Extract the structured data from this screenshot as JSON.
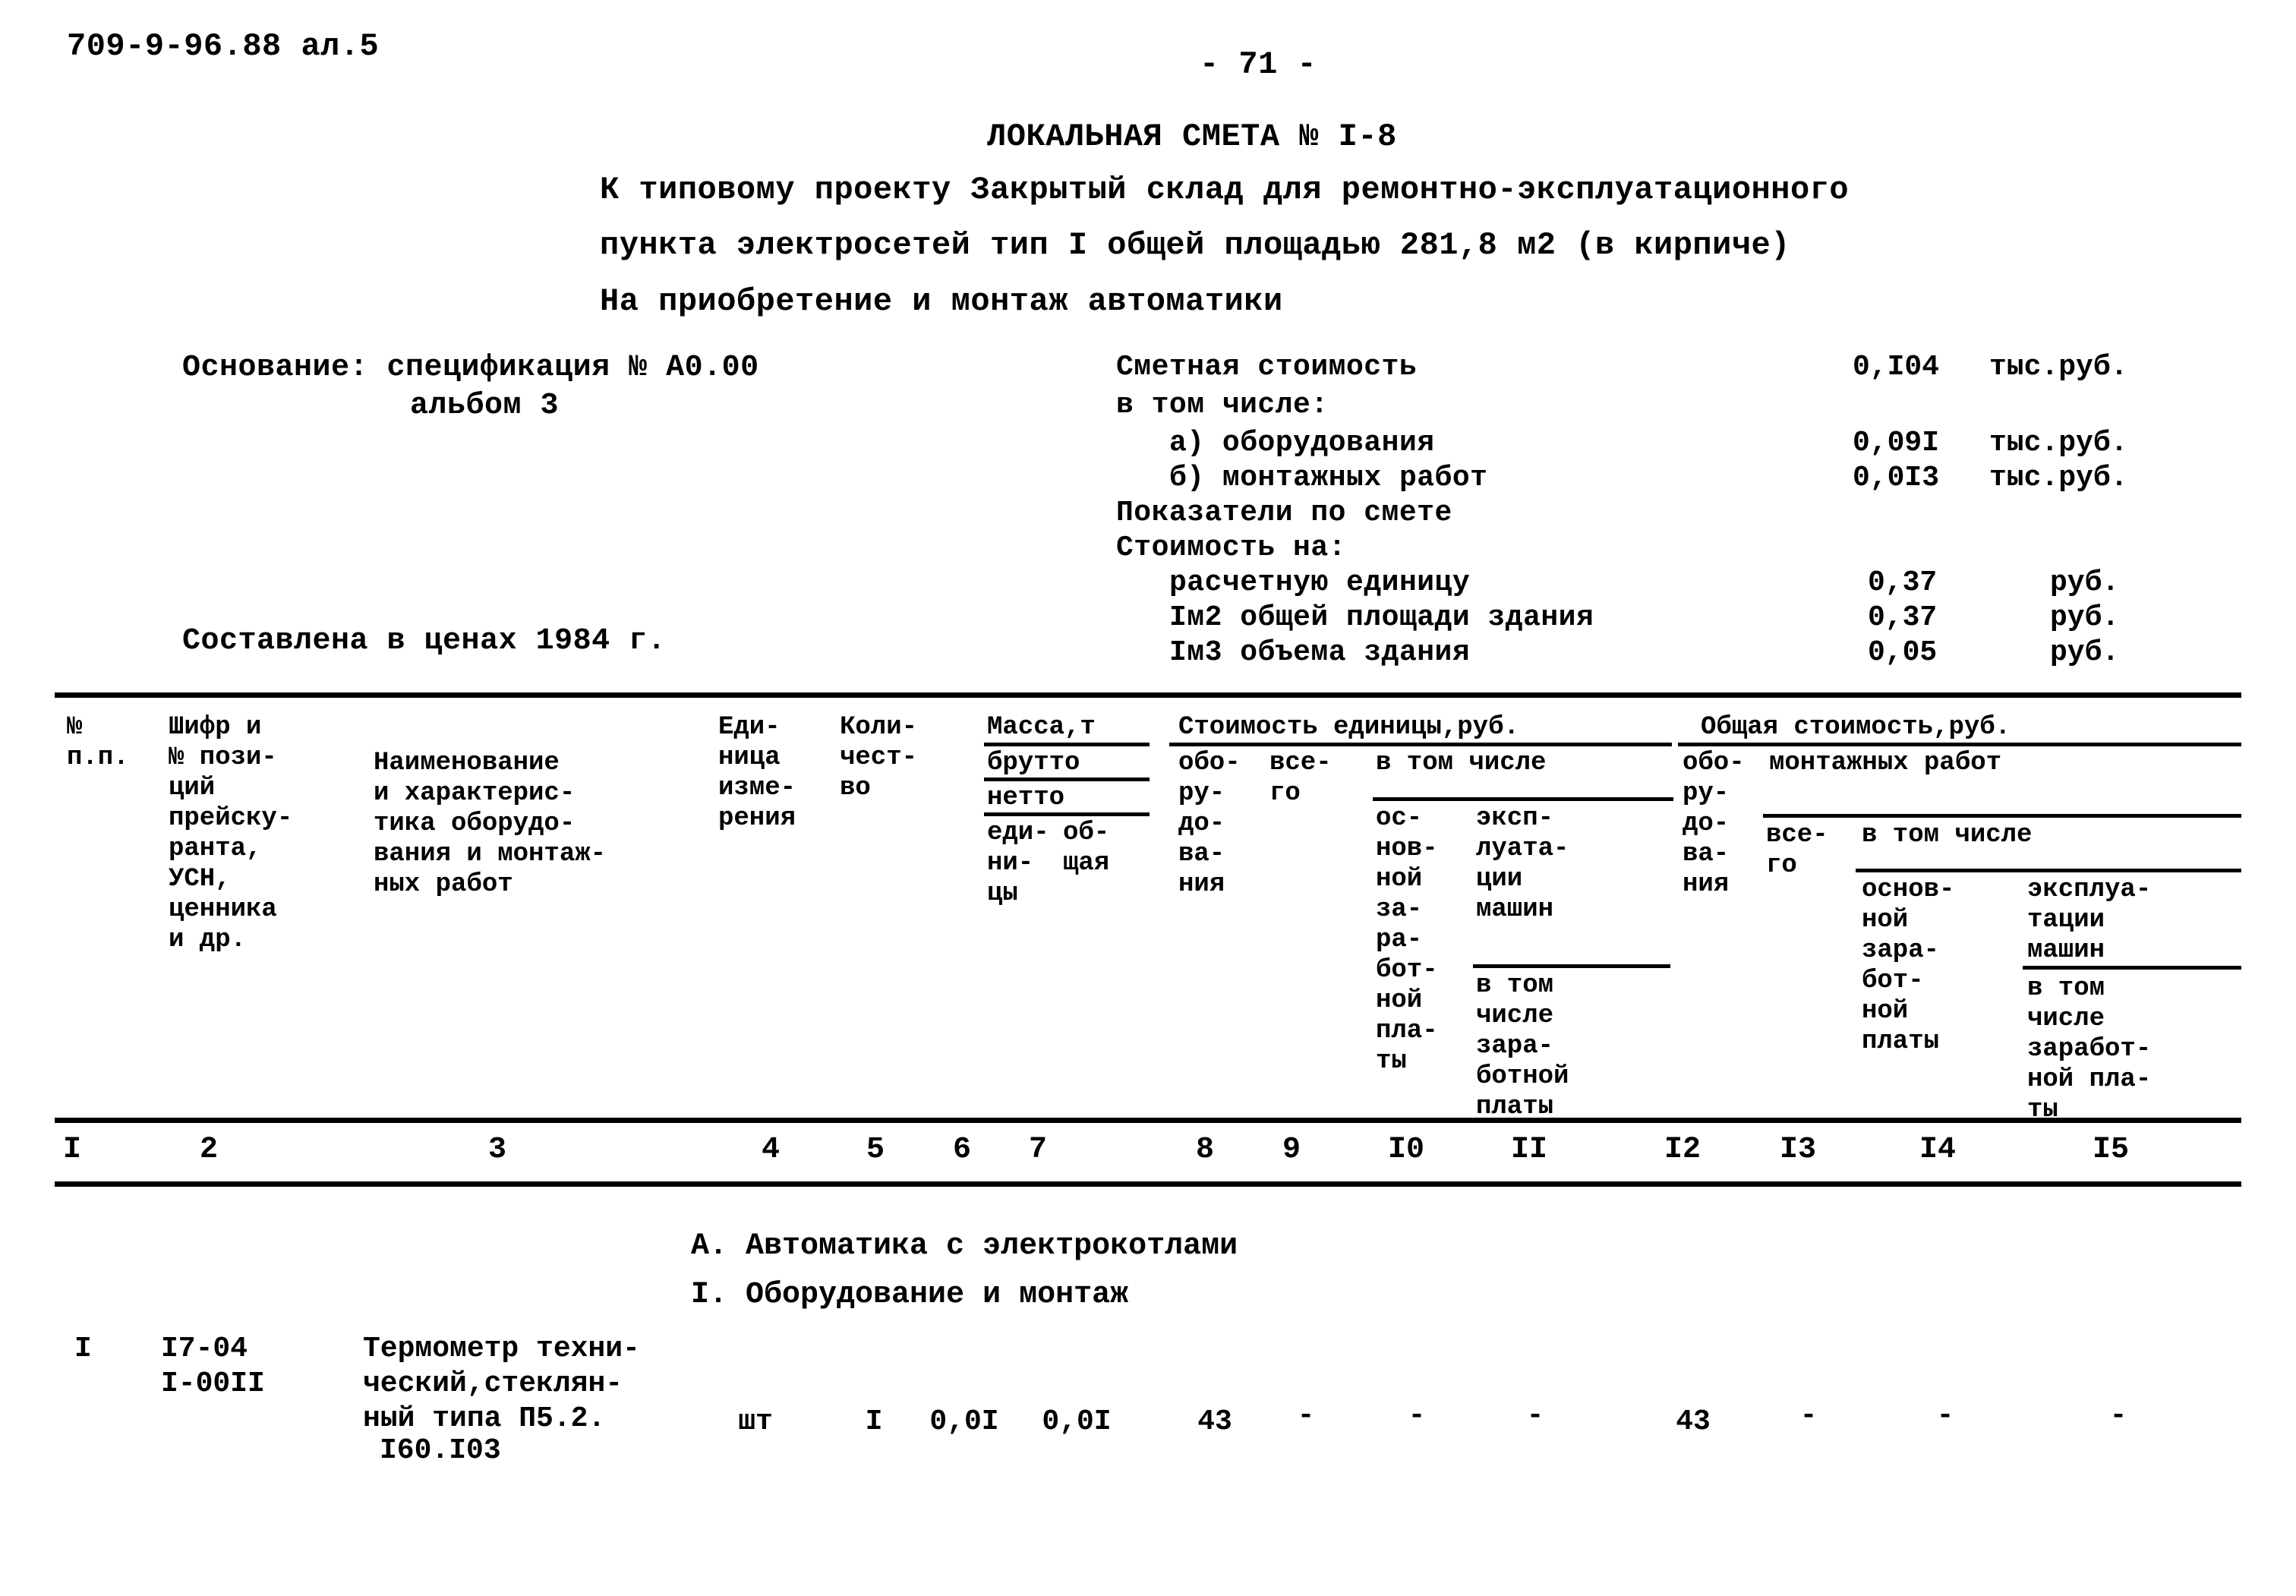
{
  "document": {
    "doc_code": "709-9-96.88 ал.5",
    "page_number": "- 71 -",
    "title": "ЛОКАЛЬНАЯ СМЕТА № I-8",
    "subtitle_line1": "К типовому проекту Закрытый склад для ремонтно-эксплуатационного",
    "subtitle_line2": "пункта электросетей тип I общей площадью 281,8 м2 (в кирпиче)",
    "subtitle_line3": "На приобретение и монтаж автоматики"
  },
  "basis": {
    "label": "Основание: спецификация № А0.00",
    "line2": "альбом 3",
    "prices_note": "Составлена в ценах 1984 г."
  },
  "summary": {
    "total_label": "Сметная стоимость",
    "total_value": "0,I04",
    "total_unit": "тыс.руб.",
    "including_label": "в том числе:",
    "equipment_label": "а) оборудования",
    "equipment_value": "0,09I",
    "equipment_unit": "тыс.руб.",
    "install_label": "б) монтажных работ",
    "install_value": "0,0I3",
    "install_unit": "тыс.руб.",
    "indicators_label": "Показатели по смете",
    "cost_per_label": "Стоимость на:",
    "unit_calc_label": "расчетную единицу",
    "unit_calc_value": "0,37",
    "unit_calc_unit": "руб.",
    "per_m2_label": "Iм2 общей площади здания",
    "per_m2_value": "0,37",
    "per_m2_unit": "руб.",
    "per_m3_label": "Iм3 объема здания",
    "per_m3_value": "0,05",
    "per_m3_unit": "руб."
  },
  "table": {
    "headers": {
      "c1": "№\nп.п.",
      "c2": "Шифр и\n№ пози-\nций\nпрейску-\nранта,\nУСН,\nценника\nи др.",
      "c3": "Наименование\nи характерис-\nтика оборудо-\nвания и монтаж-\nных работ",
      "c4": "Еди-\nница\nизме-\nрения",
      "c5": "Коли-\nчест-\nво",
      "mass_group": "Масса,т",
      "c6_top": "брутто",
      "c7_top": "нетто",
      "c6": "еди-\nни-\nцы",
      "c7": "об-\nщая",
      "unit_cost_group": "Стоимость единицы,руб.",
      "c8": "обо-\nру-\nдо-\nва-\nния",
      "c9": "все-\nго",
      "incl_unit": "в том числе",
      "c10": "ос-\nнов-\nной\nза-\nра-\nбот-\nной\nпла-\nты",
      "c11": "эксп-\nлуата-\nции\nмашин",
      "c11_sub": "в том\nчисле\nзара-\nботной\nплаты",
      "total_cost_group": "Общая стоимость,руб.",
      "c12": "обо-\nру-\nдо-\nва-\nния",
      "install_group": "монтажных работ",
      "c13": "все-\nго",
      "incl_total": "в том числе",
      "c14": "основ-\nной\nзара-\nбот-\nной\nплаты",
      "c15": "эксплуа-\nтации\nмашин",
      "c15_sub": "в том\nчисле\nзаработ-\nной пла-\nты"
    },
    "column_numbers": [
      "I",
      "2",
      "3",
      "4",
      "5",
      "6",
      "7",
      "8",
      "9",
      "I0",
      "II",
      "I2",
      "I3",
      "I4",
      "I5"
    ],
    "sections": [
      "А. Автоматика с электрокотлами",
      "I. Оборудование и монтаж"
    ],
    "rows": [
      {
        "num": "I",
        "code_line1": "I7-04",
        "code_line2": "I-00II",
        "name_line1": "Термометр техни-",
        "name_line2": "ческий,стеклян-",
        "name_line3": "ный типа П5.2.",
        "name_line4": "I60.I03",
        "unit": "шт",
        "qty": "I",
        "mass_unit": "0,0I",
        "mass_total": "0,0I",
        "cost_equip": "43",
        "cost_all": "-",
        "cost_basic_wage": "-",
        "cost_machines": "-",
        "total_equip": "43",
        "total_all": "-",
        "total_basic_wage": "-",
        "total_machines": "-"
      }
    ]
  }
}
